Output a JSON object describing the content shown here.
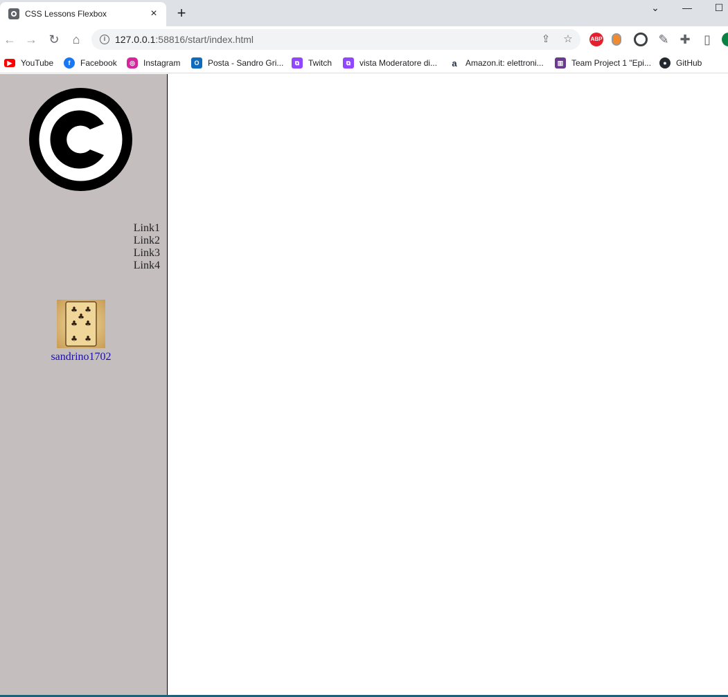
{
  "browser": {
    "tab_title": "CSS Lessons Flexbox",
    "url_host": "127.0.0.1",
    "url_path": ":58816/start/index.html",
    "window_controls": {
      "minimize": "—",
      "maximize": "☐",
      "dropdown": "⌄"
    }
  },
  "extensions": [
    {
      "name": "adblock-icon",
      "label": "ABP",
      "color": "#e4202e"
    },
    {
      "name": "extension-orange-icon",
      "label": "",
      "color": "#f28b30"
    },
    {
      "name": "record-icon",
      "label": "",
      "color": "#3c4043"
    }
  ],
  "bookmarks": [
    {
      "label": "YouTube",
      "icon": "youtube-icon",
      "color": "#ff0000"
    },
    {
      "label": "Facebook",
      "icon": "facebook-icon",
      "color": "#1877f2"
    },
    {
      "label": "Instagram",
      "icon": "instagram-icon",
      "color": "#d6249f"
    },
    {
      "label": "Posta - Sandro Gri...",
      "icon": "outlook-icon",
      "color": "#0f6cbd"
    },
    {
      "label": "Twitch",
      "icon": "twitch-icon",
      "color": "#9146ff"
    },
    {
      "label": "vista Moderatore di...",
      "icon": "twitch-icon",
      "color": "#9146ff"
    },
    {
      "label": "Amazon.it: elettroni...",
      "icon": "amazon-icon",
      "color": "#232f3e"
    },
    {
      "label": "Team Project 1 \"Epi...",
      "icon": "trello-icon",
      "color": "#6b3a8e"
    },
    {
      "label": "GitHub",
      "icon": "github-icon",
      "color": "#24292f"
    }
  ],
  "sidebar": {
    "logo": "copyright-logo",
    "links": [
      "Link1",
      "Link2",
      "Link3",
      "Link4"
    ],
    "profile": {
      "name": "sandrino1702",
      "image": "playing-card-seven-of-clubs"
    }
  },
  "colors": {
    "sidebar_bg": "#c4bebe",
    "link_color": "#1a0dab"
  }
}
